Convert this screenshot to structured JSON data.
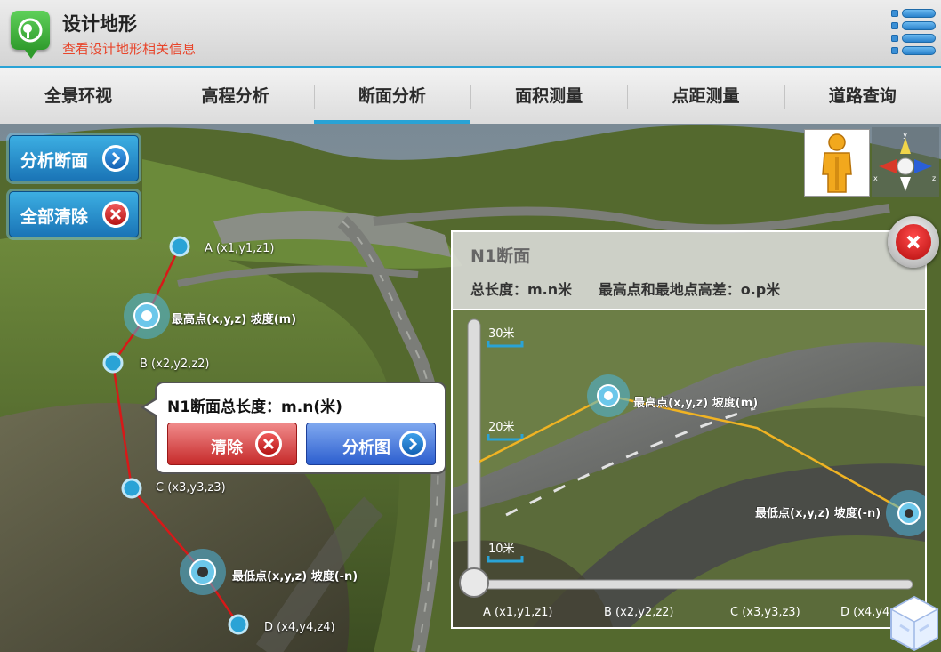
{
  "app": {
    "title": "设计地形",
    "subtitle": "查看设计地形相关信息"
  },
  "tabs": [
    {
      "label": "全景环视",
      "active": false
    },
    {
      "label": "高程分析",
      "active": false
    },
    {
      "label": "断面分析",
      "active": true
    },
    {
      "label": "面积测量",
      "active": false
    },
    {
      "label": "点距测量",
      "active": false
    },
    {
      "label": "道路查询",
      "active": false
    }
  ],
  "sidebar": {
    "analyze_label": "分析断面",
    "clear_all_label": "全部清除"
  },
  "section_points": {
    "a": "A (x1,y1,z1)",
    "highest": "最高点(x,y,z) 坡度(m)",
    "b": "B (x2,y2,z2)",
    "c": "C (x3,y3,z3)",
    "lowest": "最低点(x,y,z) 坡度(-n)",
    "d": "D (x4,y4,z4)"
  },
  "popup": {
    "title": "N1断面总长度：m.n(米)",
    "clear_label": "清除",
    "chart_label": "分析图"
  },
  "panel": {
    "title": "N1断面",
    "total_length": "总长度：m.n米",
    "height_diff": "最高点和最地点高差：o.p米"
  },
  "chart_data": {
    "type": "line",
    "y_ticks": [
      "30米",
      "20米",
      "10米"
    ],
    "x_labels": [
      "A (x1,y1,z1)",
      "B (x2,y2,z2)",
      "C (x3,y3,z3)",
      "D (x4,y4,z4)"
    ],
    "highest_label": "最高点(x,y,z) 坡度(m)",
    "lowest_label": "最低点(x,y,z) 坡度(-n)",
    "line_color": "#f0b323"
  },
  "colors": {
    "accent": "#2aa3d6",
    "route": "#d81818",
    "profile": "#f0b323"
  },
  "icons": {
    "logo": "terrain-pin-icon",
    "menu": "menu-list-icon",
    "person": "person-view-icon",
    "axis": "xyz-axis-gizmo-icon",
    "close": "close-icon",
    "cube": "cube-icon"
  }
}
